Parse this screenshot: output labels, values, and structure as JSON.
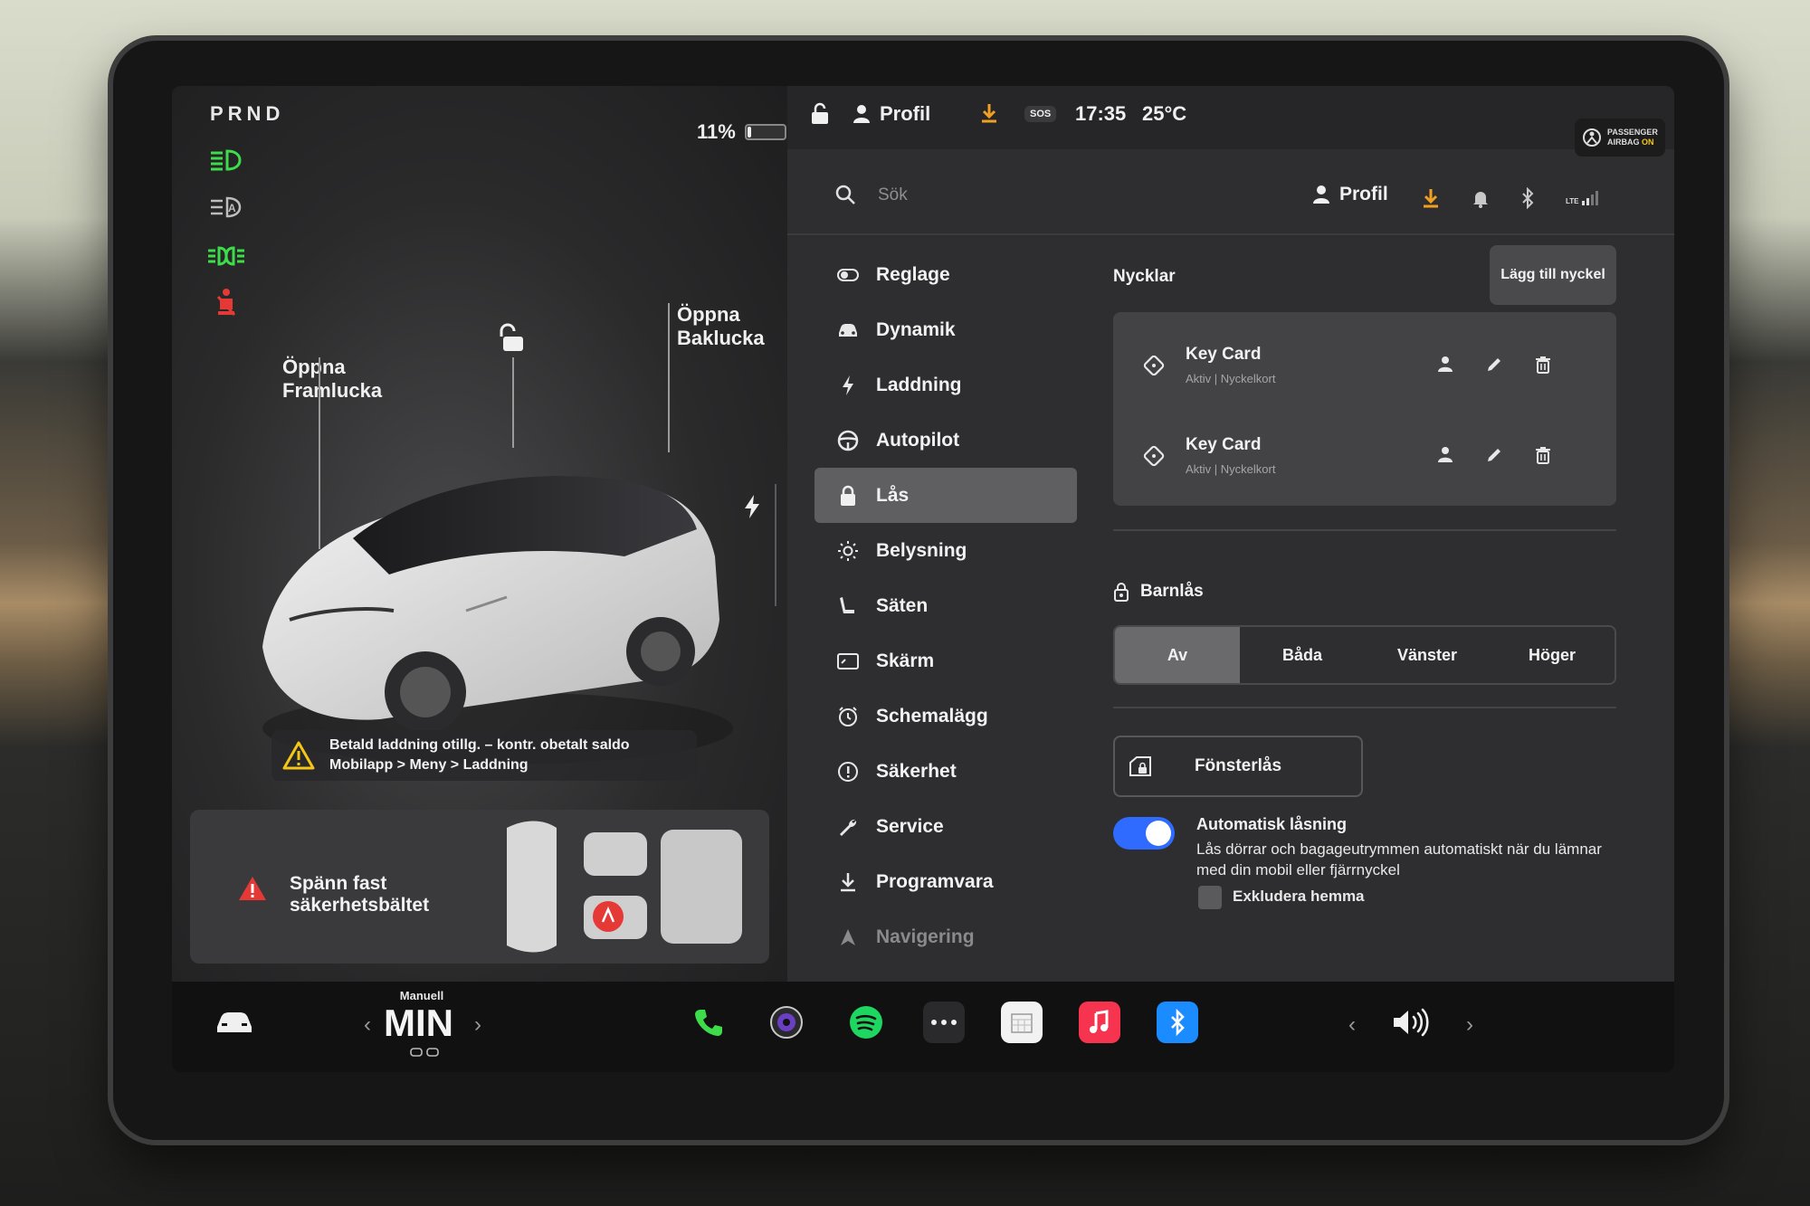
{
  "gear": "PRND",
  "battery": {
    "percent_text": "11%",
    "level": 0.11
  },
  "callouts": {
    "frunk": [
      "Öppna",
      "Framlucka"
    ],
    "trunk": [
      "Öppna",
      "Baklucka"
    ]
  },
  "charge_warning": {
    "line1": "Betald laddning otillg. – kontr. obetalt saldo",
    "line2": "Mobilapp > Meny > Laddning"
  },
  "seatbelt": {
    "line1": "Spänn fast",
    "line2": "säkerhetsbältet"
  },
  "statusbar": {
    "profile": "Profil",
    "sos": "SOS",
    "time": "17:35",
    "temp": "25°C",
    "airbag_line1": "PASSENGER",
    "airbag_line2": "AIRBAG",
    "airbag_state": "ON"
  },
  "search": {
    "placeholder": "Sök"
  },
  "header": {
    "profile": "Profil",
    "lte": "LTE"
  },
  "menu": [
    {
      "label": "Reglage",
      "icon": "toggle-icon"
    },
    {
      "label": "Dynamik",
      "icon": "car-icon"
    },
    {
      "label": "Laddning",
      "icon": "bolt-icon"
    },
    {
      "label": "Autopilot",
      "icon": "steering-wheel-icon"
    },
    {
      "label": "Lås",
      "icon": "lock-icon",
      "active": true
    },
    {
      "label": "Belysning",
      "icon": "sun-icon"
    },
    {
      "label": "Säten",
      "icon": "seat-icon"
    },
    {
      "label": "Skärm",
      "icon": "display-icon"
    },
    {
      "label": "Schemalägg",
      "icon": "clock-icon"
    },
    {
      "label": "Säkerhet",
      "icon": "alert-icon"
    },
    {
      "label": "Service",
      "icon": "wrench-icon"
    },
    {
      "label": "Programvara",
      "icon": "download-icon"
    },
    {
      "label": "Navigering",
      "icon": "navigation-icon"
    }
  ],
  "locks": {
    "keys_title": "Nycklar",
    "add_key": "Lägg till nyckel",
    "keys": [
      {
        "name": "Key Card",
        "status": "Aktiv | Nyckelkort"
      },
      {
        "name": "Key Card",
        "status": "Aktiv | Nyckelkort"
      }
    ],
    "child_lock_title": "Barnlås",
    "child_lock_options": [
      "Av",
      "Båda",
      "Vänster",
      "Höger"
    ],
    "child_lock_selected": "Av",
    "window_lock": "Fönsterlås",
    "auto_lock_title": "Automatisk låsning",
    "auto_lock_desc": "Lås dörrar och bagageutrymmen automatiskt när du lämnar med din mobil eller fjärrnyckel",
    "auto_lock_on": true,
    "exclude_home": "Exkludera hemma"
  },
  "dock": {
    "climate_mode": "Manuell",
    "climate_value": "MIN"
  },
  "colors": {
    "accent_blue": "#2f6bff",
    "telltale_green": "#3ddc4a",
    "warning_red": "#e53935",
    "download_orange": "#f0a020"
  }
}
